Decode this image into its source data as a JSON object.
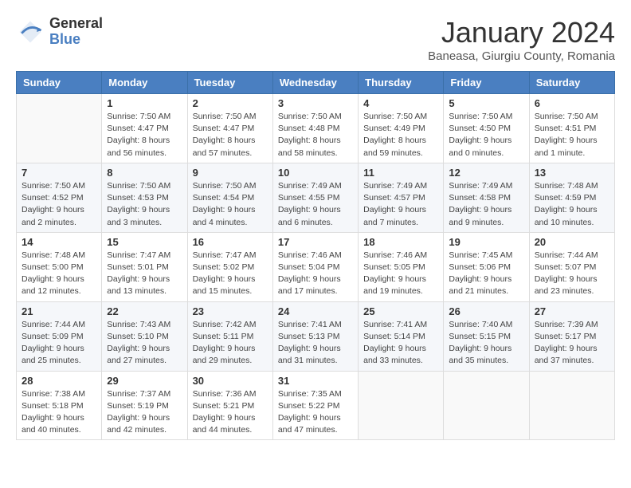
{
  "header": {
    "logo_general": "General",
    "logo_blue": "Blue",
    "month_title": "January 2024",
    "subtitle": "Baneasa, Giurgiu County, Romania"
  },
  "days_of_week": [
    "Sunday",
    "Monday",
    "Tuesday",
    "Wednesday",
    "Thursday",
    "Friday",
    "Saturday"
  ],
  "weeks": [
    [
      {
        "day": "",
        "info": ""
      },
      {
        "day": "1",
        "info": "Sunrise: 7:50 AM\nSunset: 4:47 PM\nDaylight: 8 hours\nand 56 minutes."
      },
      {
        "day": "2",
        "info": "Sunrise: 7:50 AM\nSunset: 4:47 PM\nDaylight: 8 hours\nand 57 minutes."
      },
      {
        "day": "3",
        "info": "Sunrise: 7:50 AM\nSunset: 4:48 PM\nDaylight: 8 hours\nand 58 minutes."
      },
      {
        "day": "4",
        "info": "Sunrise: 7:50 AM\nSunset: 4:49 PM\nDaylight: 8 hours\nand 59 minutes."
      },
      {
        "day": "5",
        "info": "Sunrise: 7:50 AM\nSunset: 4:50 PM\nDaylight: 9 hours\nand 0 minutes."
      },
      {
        "day": "6",
        "info": "Sunrise: 7:50 AM\nSunset: 4:51 PM\nDaylight: 9 hours\nand 1 minute."
      }
    ],
    [
      {
        "day": "7",
        "info": "Sunrise: 7:50 AM\nSunset: 4:52 PM\nDaylight: 9 hours\nand 2 minutes."
      },
      {
        "day": "8",
        "info": "Sunrise: 7:50 AM\nSunset: 4:53 PM\nDaylight: 9 hours\nand 3 minutes."
      },
      {
        "day": "9",
        "info": "Sunrise: 7:50 AM\nSunset: 4:54 PM\nDaylight: 9 hours\nand 4 minutes."
      },
      {
        "day": "10",
        "info": "Sunrise: 7:49 AM\nSunset: 4:55 PM\nDaylight: 9 hours\nand 6 minutes."
      },
      {
        "day": "11",
        "info": "Sunrise: 7:49 AM\nSunset: 4:57 PM\nDaylight: 9 hours\nand 7 minutes."
      },
      {
        "day": "12",
        "info": "Sunrise: 7:49 AM\nSunset: 4:58 PM\nDaylight: 9 hours\nand 9 minutes."
      },
      {
        "day": "13",
        "info": "Sunrise: 7:48 AM\nSunset: 4:59 PM\nDaylight: 9 hours\nand 10 minutes."
      }
    ],
    [
      {
        "day": "14",
        "info": "Sunrise: 7:48 AM\nSunset: 5:00 PM\nDaylight: 9 hours\nand 12 minutes."
      },
      {
        "day": "15",
        "info": "Sunrise: 7:47 AM\nSunset: 5:01 PM\nDaylight: 9 hours\nand 13 minutes."
      },
      {
        "day": "16",
        "info": "Sunrise: 7:47 AM\nSunset: 5:02 PM\nDaylight: 9 hours\nand 15 minutes."
      },
      {
        "day": "17",
        "info": "Sunrise: 7:46 AM\nSunset: 5:04 PM\nDaylight: 9 hours\nand 17 minutes."
      },
      {
        "day": "18",
        "info": "Sunrise: 7:46 AM\nSunset: 5:05 PM\nDaylight: 9 hours\nand 19 minutes."
      },
      {
        "day": "19",
        "info": "Sunrise: 7:45 AM\nSunset: 5:06 PM\nDaylight: 9 hours\nand 21 minutes."
      },
      {
        "day": "20",
        "info": "Sunrise: 7:44 AM\nSunset: 5:07 PM\nDaylight: 9 hours\nand 23 minutes."
      }
    ],
    [
      {
        "day": "21",
        "info": "Sunrise: 7:44 AM\nSunset: 5:09 PM\nDaylight: 9 hours\nand 25 minutes."
      },
      {
        "day": "22",
        "info": "Sunrise: 7:43 AM\nSunset: 5:10 PM\nDaylight: 9 hours\nand 27 minutes."
      },
      {
        "day": "23",
        "info": "Sunrise: 7:42 AM\nSunset: 5:11 PM\nDaylight: 9 hours\nand 29 minutes."
      },
      {
        "day": "24",
        "info": "Sunrise: 7:41 AM\nSunset: 5:13 PM\nDaylight: 9 hours\nand 31 minutes."
      },
      {
        "day": "25",
        "info": "Sunrise: 7:41 AM\nSunset: 5:14 PM\nDaylight: 9 hours\nand 33 minutes."
      },
      {
        "day": "26",
        "info": "Sunrise: 7:40 AM\nSunset: 5:15 PM\nDaylight: 9 hours\nand 35 minutes."
      },
      {
        "day": "27",
        "info": "Sunrise: 7:39 AM\nSunset: 5:17 PM\nDaylight: 9 hours\nand 37 minutes."
      }
    ],
    [
      {
        "day": "28",
        "info": "Sunrise: 7:38 AM\nSunset: 5:18 PM\nDaylight: 9 hours\nand 40 minutes."
      },
      {
        "day": "29",
        "info": "Sunrise: 7:37 AM\nSunset: 5:19 PM\nDaylight: 9 hours\nand 42 minutes."
      },
      {
        "day": "30",
        "info": "Sunrise: 7:36 AM\nSunset: 5:21 PM\nDaylight: 9 hours\nand 44 minutes."
      },
      {
        "day": "31",
        "info": "Sunrise: 7:35 AM\nSunset: 5:22 PM\nDaylight: 9 hours\nand 47 minutes."
      },
      {
        "day": "",
        "info": ""
      },
      {
        "day": "",
        "info": ""
      },
      {
        "day": "",
        "info": ""
      }
    ]
  ]
}
